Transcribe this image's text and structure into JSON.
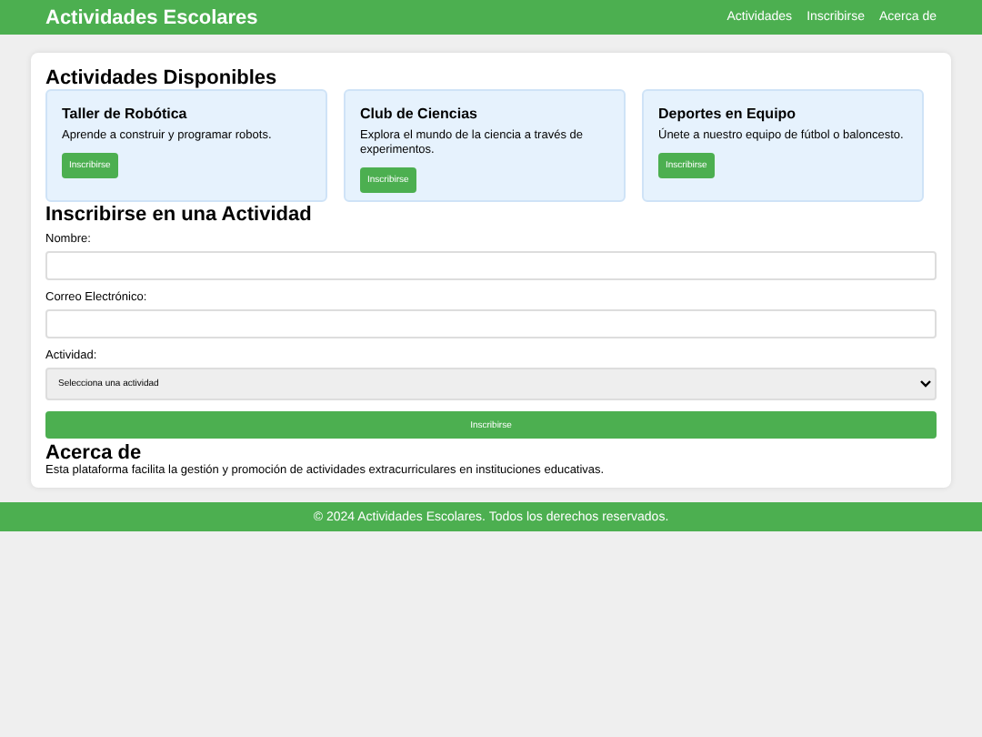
{
  "header": {
    "title": "Actividades Escolares",
    "nav": [
      "Actividades",
      "Inscribirse",
      "Acerca de"
    ]
  },
  "activities": {
    "heading": "Actividades Disponibles",
    "cards": [
      {
        "title": "Taller de Robótica",
        "description": "Aprende a construir y programar robots.",
        "button": "Inscribirse"
      },
      {
        "title": "Club de Ciencias",
        "description": "Explora el mundo de la ciencia a través de experimentos.",
        "button": "Inscribirse"
      },
      {
        "title": "Deportes en Equipo",
        "description": "Únete a nuestro equipo de fútbol o baloncesto.",
        "button": "Inscribirse"
      }
    ]
  },
  "form": {
    "heading": "Inscribirse en una Actividad",
    "name_label": "Nombre:",
    "email_label": "Correo Electrónico:",
    "activity_label": "Actividad:",
    "activity_select": "Selecciona una actividad",
    "submit": "Inscribirse"
  },
  "about": {
    "heading": "Acerca de",
    "text": "Esta plataforma facilita la gestión y promoción de actividades extracurriculares en instituciones educativas."
  },
  "footer": {
    "text": "© 2024 Actividades Escolares. Todos los derechos reservados."
  }
}
